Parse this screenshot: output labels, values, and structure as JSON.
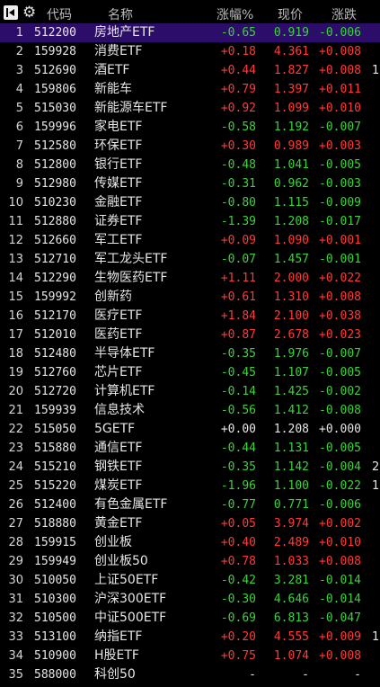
{
  "header": {
    "col_code": "代码",
    "col_name": "名称",
    "col_pct": "涨幅%",
    "col_price": "现价",
    "col_chg": "涨跌"
  },
  "rows": [
    {
      "idx": "1",
      "code": "512200",
      "name": "房地产ETF",
      "pct": "-0.65",
      "price": "0.919",
      "chg": "-0.006",
      "dir": "down",
      "extra": ""
    },
    {
      "idx": "2",
      "code": "159928",
      "name": "消费ETF",
      "pct": "+0.18",
      "price": "4.361",
      "chg": "+0.008",
      "dir": "up",
      "extra": ""
    },
    {
      "idx": "3",
      "code": "512690",
      "name": "酒ETF",
      "pct": "+0.44",
      "price": "1.827",
      "chg": "+0.008",
      "dir": "up",
      "extra": "1"
    },
    {
      "idx": "4",
      "code": "159806",
      "name": "新能车",
      "pct": "+0.79",
      "price": "1.397",
      "chg": "+0.011",
      "dir": "up",
      "extra": ""
    },
    {
      "idx": "5",
      "code": "515030",
      "name": "新能源车ETF",
      "pct": "+0.92",
      "price": "1.099",
      "chg": "+0.010",
      "dir": "up",
      "extra": ""
    },
    {
      "idx": "6",
      "code": "159996",
      "name": "家电ETF",
      "pct": "-0.58",
      "price": "1.192",
      "chg": "-0.007",
      "dir": "down",
      "extra": ""
    },
    {
      "idx": "7",
      "code": "512580",
      "name": "环保ETF",
      "pct": "+0.30",
      "price": "0.989",
      "chg": "+0.003",
      "dir": "up",
      "extra": ""
    },
    {
      "idx": "8",
      "code": "512800",
      "name": "银行ETF",
      "pct": "-0.48",
      "price": "1.041",
      "chg": "-0.005",
      "dir": "down",
      "extra": ""
    },
    {
      "idx": "9",
      "code": "512980",
      "name": "传媒ETF",
      "pct": "-0.31",
      "price": "0.962",
      "chg": "-0.003",
      "dir": "down",
      "extra": ""
    },
    {
      "idx": "10",
      "code": "510230",
      "name": "金融ETF",
      "pct": "-0.80",
      "price": "1.115",
      "chg": "-0.009",
      "dir": "down",
      "extra": ""
    },
    {
      "idx": "11",
      "code": "512880",
      "name": "证券ETF",
      "pct": "-1.39",
      "price": "1.208",
      "chg": "-0.017",
      "dir": "down",
      "extra": ""
    },
    {
      "idx": "12",
      "code": "512660",
      "name": "军工ETF",
      "pct": "+0.09",
      "price": "1.090",
      "chg": "+0.001",
      "dir": "up",
      "extra": ""
    },
    {
      "idx": "13",
      "code": "512710",
      "name": "军工龙头ETF",
      "pct": "-0.07",
      "price": "1.457",
      "chg": "-0.001",
      "dir": "down",
      "extra": ""
    },
    {
      "idx": "14",
      "code": "512290",
      "name": "生物医药ETF",
      "pct": "+1.11",
      "price": "2.000",
      "chg": "+0.022",
      "dir": "up",
      "extra": ""
    },
    {
      "idx": "15",
      "code": "159992",
      "name": "创新药",
      "pct": "+0.61",
      "price": "1.310",
      "chg": "+0.008",
      "dir": "up",
      "extra": ""
    },
    {
      "idx": "16",
      "code": "512170",
      "name": "医疗ETF",
      "pct": "+1.84",
      "price": "2.100",
      "chg": "+0.038",
      "dir": "up",
      "extra": ""
    },
    {
      "idx": "17",
      "code": "512010",
      "name": "医药ETF",
      "pct": "+0.87",
      "price": "2.678",
      "chg": "+0.023",
      "dir": "up",
      "extra": ""
    },
    {
      "idx": "18",
      "code": "512480",
      "name": "半导体ETF",
      "pct": "-0.35",
      "price": "1.976",
      "chg": "-0.007",
      "dir": "down",
      "extra": ""
    },
    {
      "idx": "19",
      "code": "512760",
      "name": "芯片ETF",
      "pct": "-0.45",
      "price": "1.107",
      "chg": "-0.005",
      "dir": "down",
      "extra": ""
    },
    {
      "idx": "20",
      "code": "512720",
      "name": "计算机ETF",
      "pct": "-0.14",
      "price": "1.425",
      "chg": "-0.002",
      "dir": "down",
      "extra": ""
    },
    {
      "idx": "21",
      "code": "159939",
      "name": "信息技术",
      "pct": "-0.56",
      "price": "1.412",
      "chg": "-0.008",
      "dir": "down",
      "extra": ""
    },
    {
      "idx": "22",
      "code": "515050",
      "name": "5GETF",
      "pct": "+0.00",
      "price": "1.208",
      "chg": "+0.000",
      "dir": "flat",
      "extra": ""
    },
    {
      "idx": "23",
      "code": "515880",
      "name": "通信ETF",
      "pct": "-0.44",
      "price": "1.131",
      "chg": "-0.005",
      "dir": "down",
      "extra": ""
    },
    {
      "idx": "24",
      "code": "515210",
      "name": "钢铁ETF",
      "pct": "-0.35",
      "price": "1.142",
      "chg": "-0.004",
      "dir": "down",
      "extra": "2"
    },
    {
      "idx": "25",
      "code": "515220",
      "name": "煤炭ETF",
      "pct": "-1.96",
      "price": "1.100",
      "chg": "-0.022",
      "dir": "down",
      "extra": "1"
    },
    {
      "idx": "26",
      "code": "512400",
      "name": "有色金属ETF",
      "pct": "-0.77",
      "price": "0.771",
      "chg": "-0.006",
      "dir": "down",
      "extra": ""
    },
    {
      "idx": "27",
      "code": "518880",
      "name": "黄金ETF",
      "pct": "+0.05",
      "price": "3.974",
      "chg": "+0.002",
      "dir": "up",
      "extra": ""
    },
    {
      "idx": "28",
      "code": "159915",
      "name": "创业板",
      "pct": "+0.40",
      "price": "2.489",
      "chg": "+0.010",
      "dir": "up",
      "extra": ""
    },
    {
      "idx": "29",
      "code": "159949",
      "name": "创业板50",
      "pct": "+0.78",
      "price": "1.033",
      "chg": "+0.008",
      "dir": "up",
      "extra": ""
    },
    {
      "idx": "30",
      "code": "510050",
      "name": "上证50ETF",
      "pct": "-0.42",
      "price": "3.281",
      "chg": "-0.014",
      "dir": "down",
      "extra": ""
    },
    {
      "idx": "31",
      "code": "510300",
      "name": "沪深300ETF",
      "pct": "-0.30",
      "price": "4.646",
      "chg": "-0.014",
      "dir": "down",
      "extra": ""
    },
    {
      "idx": "32",
      "code": "510500",
      "name": "中证500ETF",
      "pct": "-0.69",
      "price": "6.813",
      "chg": "-0.047",
      "dir": "down",
      "extra": ""
    },
    {
      "idx": "33",
      "code": "513100",
      "name": "纳指ETF",
      "pct": "+0.20",
      "price": "4.555",
      "chg": "+0.009",
      "dir": "up",
      "extra": "1"
    },
    {
      "idx": "34",
      "code": "510900",
      "name": "H股ETF",
      "pct": "+0.75",
      "price": "1.074",
      "chg": "+0.008",
      "dir": "up",
      "extra": ""
    },
    {
      "idx": "35",
      "code": "588000",
      "name": "科创50",
      "pct": "-",
      "price": "-",
      "chg": "-",
      "dir": "flat",
      "extra": ""
    }
  ],
  "selected_row": "1",
  "colors": {
    "up": "#ff3a3a",
    "down": "#3cd23c",
    "selected_bg": "#2c0e6a"
  },
  "icons": [
    "back-to-start-icon",
    "gear-icon"
  ]
}
